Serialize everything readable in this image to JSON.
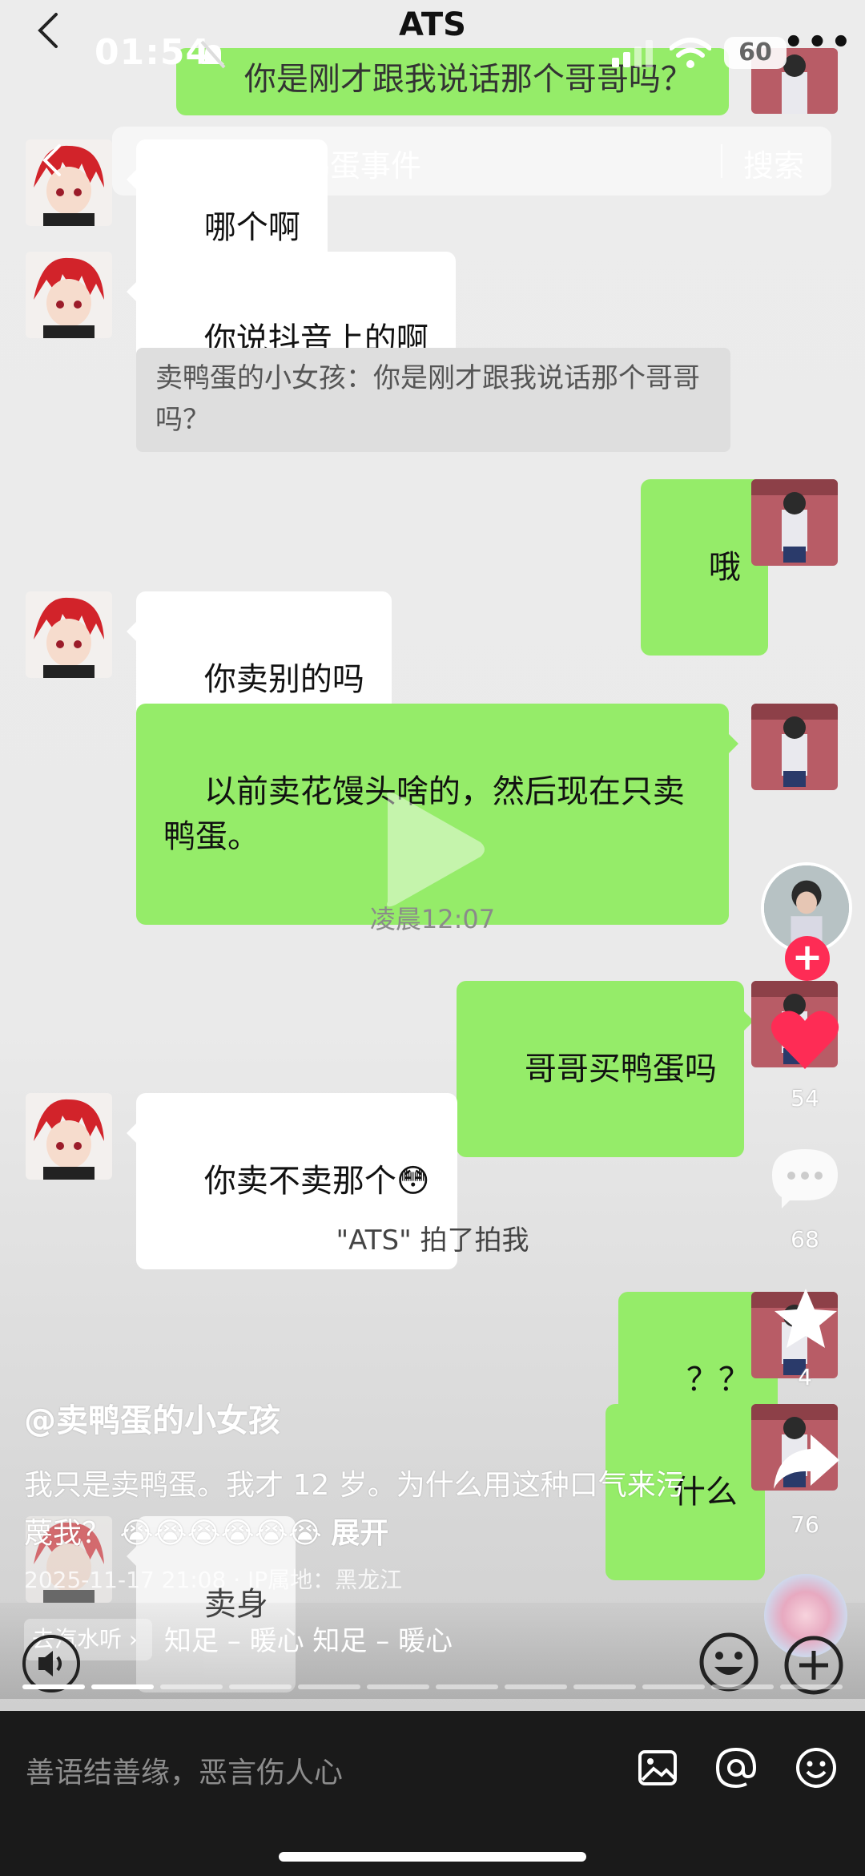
{
  "status": {
    "time": "01:54",
    "battery": "60"
  },
  "header": {
    "title": "ATS"
  },
  "search": {
    "query": "小女孩卖鸭蛋事件",
    "button": "搜索"
  },
  "chat": {
    "top_partial": "你是刚才跟我说话那个哥哥吗？",
    "msg_1": "哪个啊",
    "msg_2": "你说抖音上的啊",
    "quote": "卖鸭蛋的小女孩：你是刚才跟我说话那个哥哥吗？",
    "msg_3": "哦",
    "msg_4": "你卖别的吗",
    "msg_5": "以前卖花馒头啥的，然后现在只卖\n鸭蛋。",
    "timestamp": "凌晨12:07",
    "msg_6": "哥哥买鸭蛋吗",
    "msg_7": "你卖不卖那个😳",
    "pat": "\"ATS\" 拍了拍我",
    "msg_8": "？？",
    "msg_9": "什么",
    "msg_10": "卖身"
  },
  "video": {
    "author": "@卖鸭蛋的小女孩",
    "description": "我只是卖鸭蛋。我才 12 岁。为什么用这种口气来污蔑我？ 😭😭😭😭😭😭",
    "expand": "展开",
    "meta": "2025-11-17 21:08 · IP属地：黑龙江",
    "likes": "54",
    "comments": "68",
    "favorites": "4",
    "shares": "76",
    "qishui": "去汽水听 ›",
    "music": "知足 – 暖心     知足 – 暖心",
    "progress_segments": 12,
    "progress_active": 2
  },
  "bottom": {
    "placeholder": "善语结善缘，恶言伤人心"
  },
  "icons": [
    "back-icon",
    "more-icon",
    "bell-mute-icon",
    "signal-icon",
    "wifi-icon",
    "search-icon",
    "play-icon",
    "follow-plus-icon",
    "heart-icon",
    "comment-icon",
    "star-icon",
    "share-icon",
    "image-icon",
    "at-icon",
    "emoji-icon",
    "sound-icon",
    "music-disc-icon"
  ],
  "colors": {
    "green_bubble": "#95ec69",
    "like_red": "#fe2c55",
    "bottom_bg": "#1a1a1a"
  }
}
